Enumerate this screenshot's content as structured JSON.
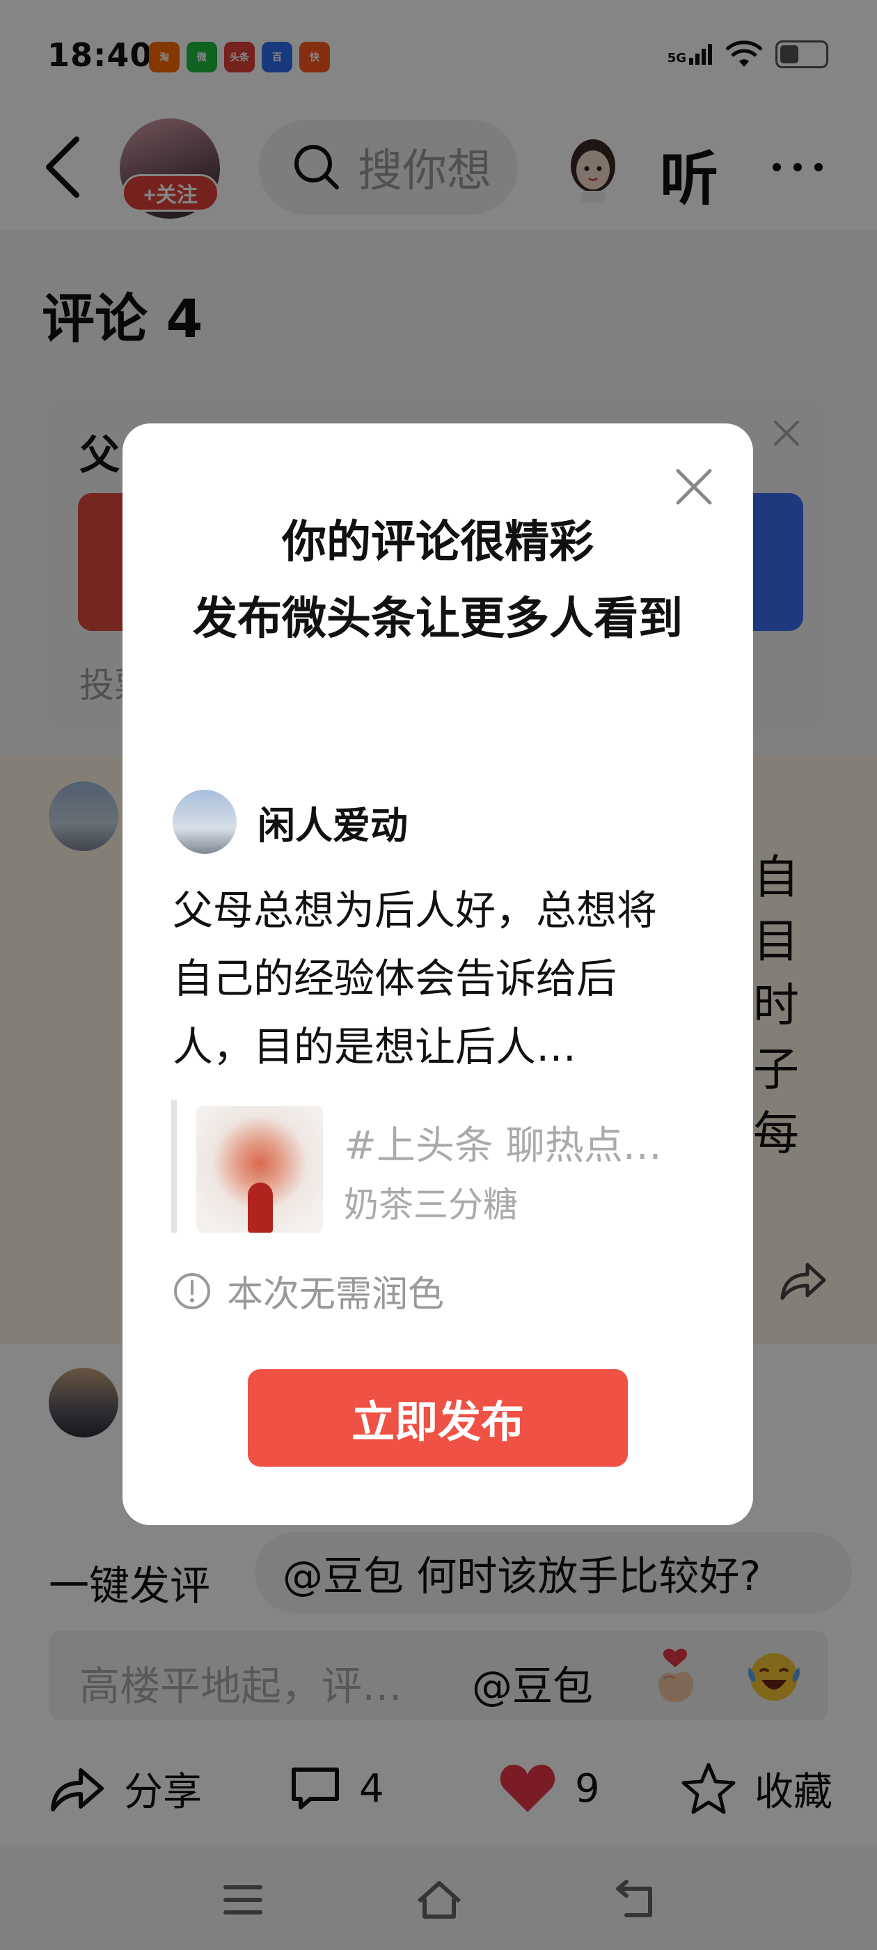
{
  "status_bar": {
    "time": "18:40",
    "apps": [
      {
        "icon": "taobao-icon",
        "label": "淘",
        "color": "#ff6a00"
      },
      {
        "icon": "wechat-icon",
        "label": "微",
        "color": "#1fbd3f"
      },
      {
        "icon": "toutiao-icon",
        "label": "头条",
        "color": "#e0403a"
      },
      {
        "icon": "baidu-icon",
        "label": "百",
        "color": "#2f6df0"
      },
      {
        "icon": "kuaishou-icon",
        "label": "快",
        "color": "#ff5a1f"
      }
    ],
    "network": "5G",
    "battery_level": 0.35
  },
  "header": {
    "follow_label": "+关注",
    "search_placeholder": "搜你想",
    "listen_label": "听"
  },
  "comments_title": "评论 4",
  "poll": {
    "question": "父",
    "footer": "投票"
  },
  "comment_side_text": [
    "自",
    "目",
    "时",
    "子",
    "每"
  ],
  "quick_comment": {
    "label": "一键发评",
    "suggestion": "@豆包 何时该放手比较好?"
  },
  "input": {
    "placeholder": "高楼平地起，评…",
    "mention": "@豆包"
  },
  "actions": {
    "share": "分享",
    "comment_count": "4",
    "like_count": "9",
    "collect": "收藏"
  },
  "modal": {
    "title_lines": [
      "你的评论很精彩",
      "发布微头条让更多人看到"
    ],
    "user_name": "闲人爱动",
    "body_text": "父母总想为后人好，总想将自己的经验体会告诉给后人，目的是想让后人…",
    "quote_tag": "#上头条 聊热点…",
    "quote_author": "奶茶三分糖",
    "note": "本次无需润色",
    "publish_button": "立即发布"
  }
}
